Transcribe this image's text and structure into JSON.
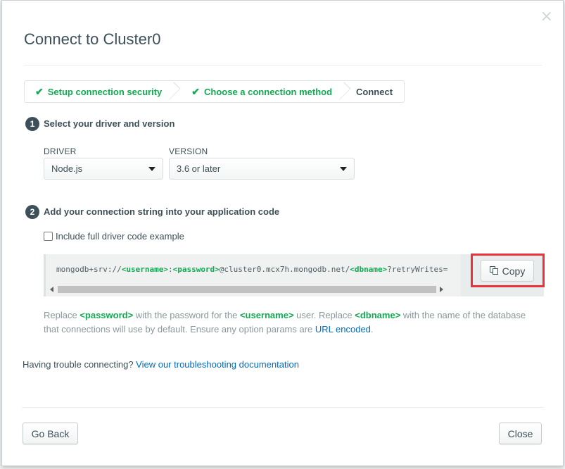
{
  "dialog": {
    "title": "Connect to Cluster0",
    "close_glyph": "×"
  },
  "steps": [
    {
      "label": "Setup connection security",
      "done": true
    },
    {
      "label": "Choose a connection method",
      "done": true
    },
    {
      "label": "Connect",
      "done": false
    }
  ],
  "section1": {
    "number": "1",
    "title": "Select your driver and version",
    "driver_label": "DRIVER",
    "driver_value": "Node.js",
    "version_label": "VERSION",
    "version_value": "3.6 or later"
  },
  "section2": {
    "number": "2",
    "title": "Add your connection string into your application code",
    "checkbox_label": "Include full driver code example",
    "checkbox_checked": false,
    "connection_string": {
      "p1": "mongodb+srv://",
      "username": "<username>",
      "p2": ":",
      "password": "<password>",
      "p3": "@cluster0.mcx7h.mongodb.net/",
      "dbname": "<dbname>",
      "p4": "?retryWrites="
    },
    "copy_label": "Copy",
    "desc": {
      "t1": "Replace ",
      "password": "<password>",
      "t2": " with the password for the ",
      "username": "<username>",
      "t3": " user. Replace ",
      "dbname": "<dbname>",
      "t4": " with the name of the database that connections will use by default. Ensure any option params are ",
      "link": "URL encoded",
      "t5": "."
    }
  },
  "trouble": {
    "text": "Having trouble connecting? ",
    "link": "View our troubleshooting documentation"
  },
  "footer": {
    "back_label": "Go Back",
    "close_label": "Close"
  },
  "colors": {
    "accent_green": "#13aa52",
    "link_blue": "#006cbc",
    "highlight_red": "#e8333c"
  }
}
